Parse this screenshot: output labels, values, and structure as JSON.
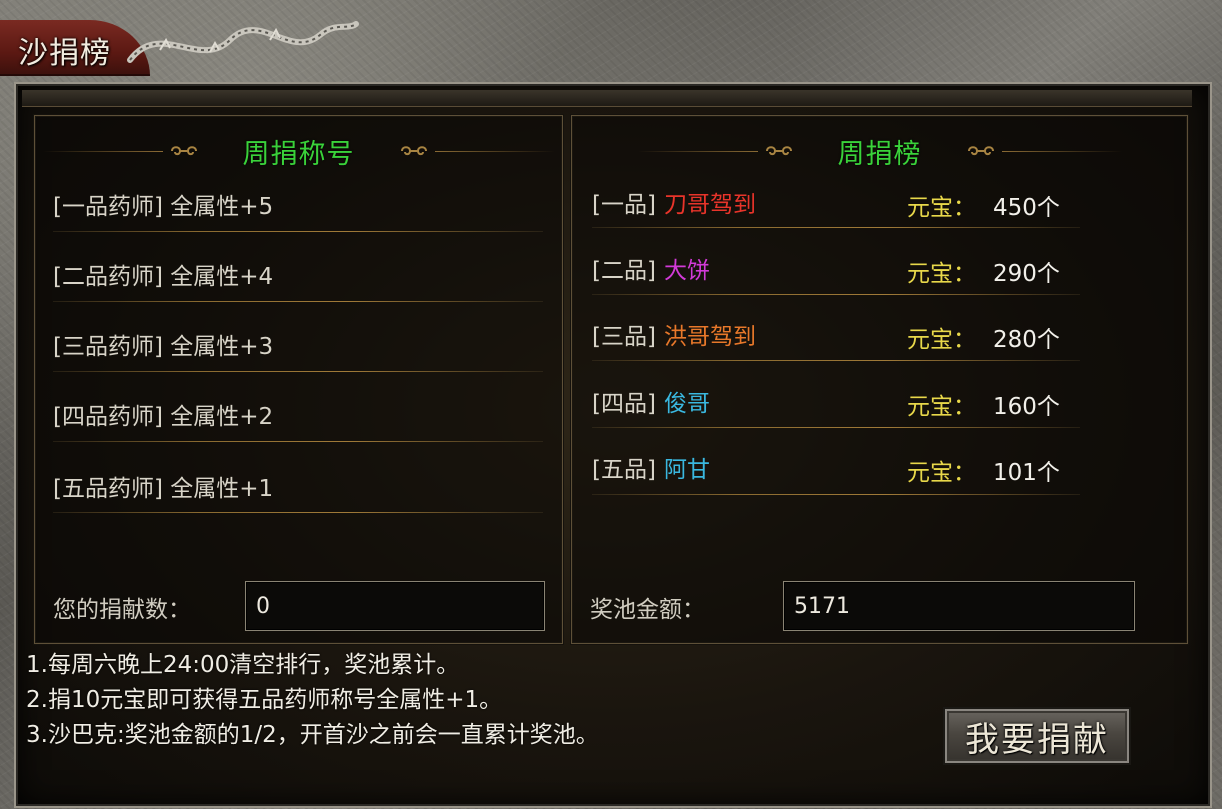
{
  "window": {
    "title": "沙捐榜"
  },
  "left_panel": {
    "title": "周捐称号",
    "titles": [
      "[一品药师] 全属性+5",
      "[二品药师] 全属性+4",
      "[三品药师] 全属性+3",
      "[四品药师] 全属性+2",
      "[五品药师] 全属性+1"
    ],
    "donation_label": "您的捐献数：",
    "donation_value": "0"
  },
  "right_panel": {
    "title": "周捐榜",
    "ranks": [
      {
        "rank": "[一品]",
        "name": "刀哥驾到",
        "name_color": "#e8342a",
        "currency_label": "元宝：",
        "amount": "450个"
      },
      {
        "rank": "[二品]",
        "name": "大饼",
        "name_color": "#d23ad8",
        "currency_label": "元宝：",
        "amount": "290个"
      },
      {
        "rank": "[三品]",
        "name": "洪哥驾到",
        "name_color": "#e8782a",
        "currency_label": "元宝：",
        "amount": "280个"
      },
      {
        "rank": "[四品]",
        "name": "俊哥",
        "name_color": "#3ab8e0",
        "currency_label": "元宝：",
        "amount": "160个"
      },
      {
        "rank": "[五品]",
        "name": "阿甘",
        "name_color": "#3ab8e0",
        "currency_label": "元宝：",
        "amount": "101个"
      }
    ],
    "pool_label": "奖池金额：",
    "pool_value": "5171"
  },
  "notes": [
    "1.每周六晚上24:00清空排行，奖池累计。",
    "2.捐10元宝即可获得五品药师称号全属性+1。",
    "3.沙巴克:奖池金额的1/2，开首沙之前会一直累计奖池。"
  ],
  "donate_button": {
    "label": "我要捐献"
  },
  "colors": {
    "header_green": "#3ad23a",
    "currency_yellow": "#e8d84a"
  }
}
